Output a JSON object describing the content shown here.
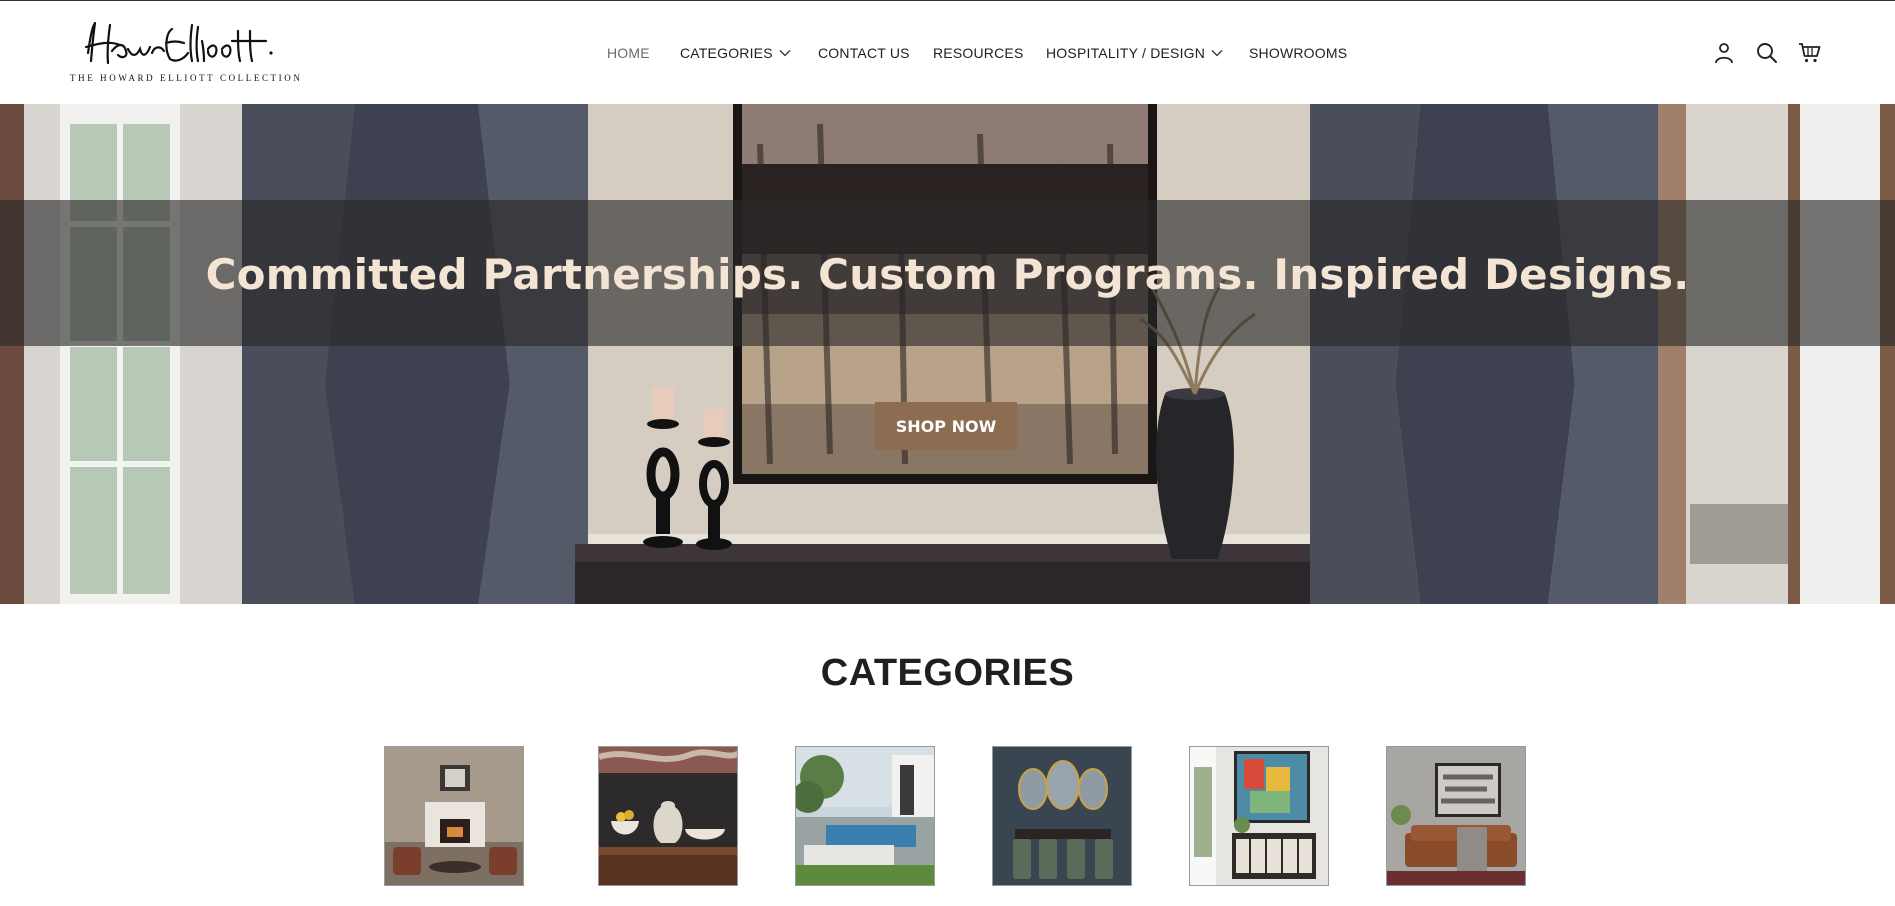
{
  "header": {
    "logo_signature": "Howard Elliott",
    "logo_tagline": "THE HOWARD ELLIOTT COLLECTION"
  },
  "nav": {
    "items": [
      {
        "label": "HOME",
        "active": true
      },
      {
        "label": "CATEGORIES",
        "dropdown": true
      },
      {
        "label": "CONTACT US"
      },
      {
        "label": "RESOURCES"
      },
      {
        "label": "HOSPITALITY / DESIGN",
        "dropdown": true
      },
      {
        "label": "SHOWROOMS"
      }
    ]
  },
  "header_icons": [
    "account-icon",
    "search-icon",
    "cart-icon"
  ],
  "hero": {
    "headline": "Committed Partnerships. Custom Programs. Inspired Designs.",
    "cta_label": "SHOP NOW"
  },
  "categories": {
    "title": "CATEGORIES",
    "thumbnails": [
      {
        "name": "living-room-fireplace-image"
      },
      {
        "name": "ceramic-vases-image"
      },
      {
        "name": "outdoor-pool-image"
      },
      {
        "name": "oval-mirrors-dining-image"
      },
      {
        "name": "abstract-art-console-image"
      },
      {
        "name": "abstract-art-sofa-image"
      }
    ]
  },
  "colors": {
    "cta_background": "#8d6d52",
    "headline_color": "#f3e4d3",
    "nav_active": "#6b6b6b"
  }
}
